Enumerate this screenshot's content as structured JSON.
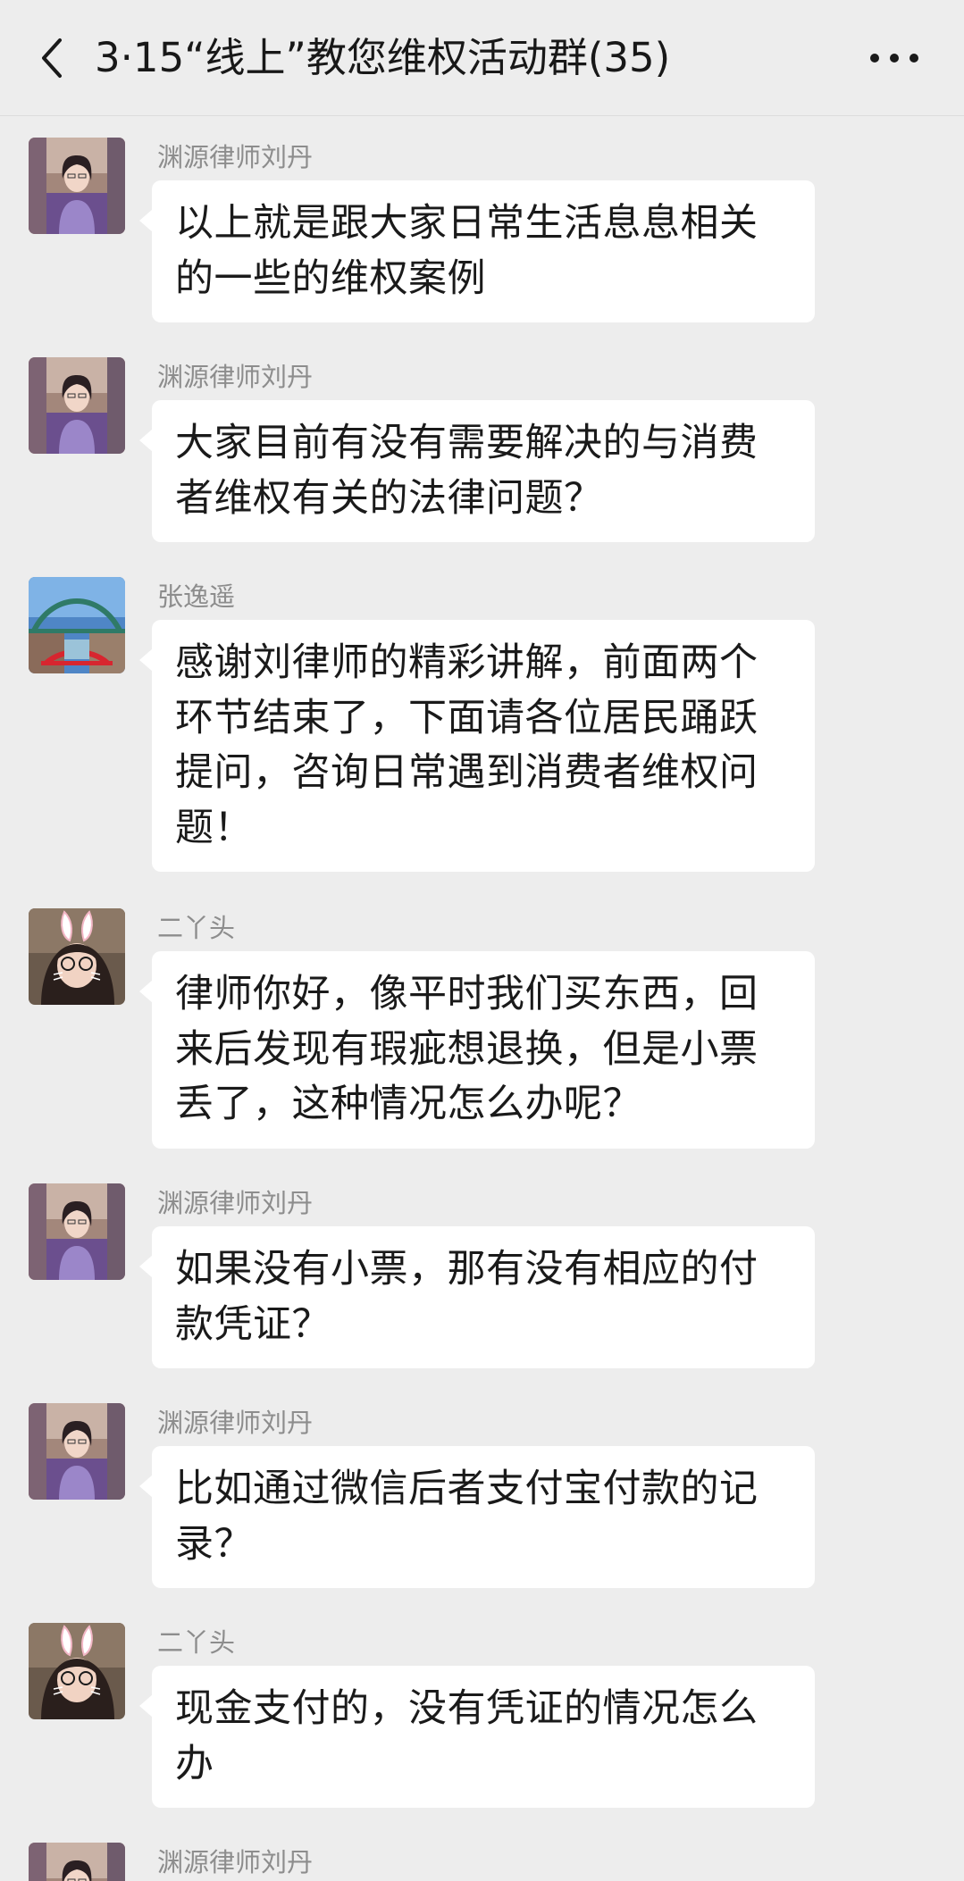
{
  "header": {
    "title": "3·15“线上”教您维权活动群(35)",
    "back_icon": "chevron-left-icon",
    "more_icon": "more-dots-icon"
  },
  "messages": [
    {
      "sender": "渊源律师刘丹",
      "avatar": "lawyer",
      "text": "以上就是跟大家日常生活息息相关的一些的维权案例"
    },
    {
      "sender": "渊源律师刘丹",
      "avatar": "lawyer",
      "text": "大家目前有没有需要解决的与消费者维权有关的法律问题？"
    },
    {
      "sender": "张逸遥",
      "avatar": "bridge",
      "text": "感谢刘律师的精彩讲解，前面两个环节结束了，下面请各位居民踊跃提问，咨询日常遇到消费者维权问题！"
    },
    {
      "sender": "二丫头",
      "avatar": "bunny",
      "text": "律师你好，像平时我们买东西，回来后发现有瑕疵想退换，但是小票丢了，这种情况怎么办呢？"
    },
    {
      "sender": "渊源律师刘丹",
      "avatar": "lawyer",
      "text": "如果没有小票，那有没有相应的付款凭证？"
    },
    {
      "sender": "渊源律师刘丹",
      "avatar": "lawyer",
      "text": "比如通过微信后者支付宝付款的记录？"
    },
    {
      "sender": "二丫头",
      "avatar": "bunny",
      "text": "现金支付的，没有凭证的情况怎么办"
    },
    {
      "sender": "渊源律师刘丹",
      "avatar": "lawyer",
      "text": ""
    }
  ],
  "colors": {
    "background": "#ededed",
    "bubble": "#ffffff",
    "sender_name": "#8d8d8d",
    "text": "#1a1a1a"
  }
}
